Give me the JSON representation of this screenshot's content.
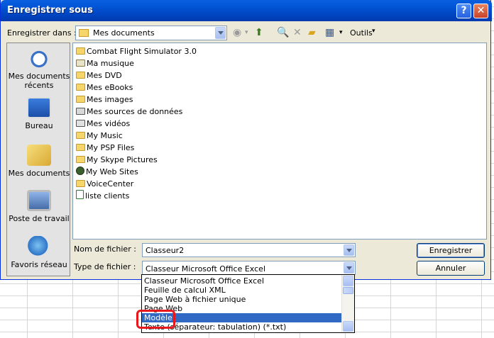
{
  "window": {
    "title": "Enregistrer sous",
    "help_glyph": "?",
    "close_glyph": "✕"
  },
  "toolbar": {
    "save_in_label": "Enregistrer dans :",
    "save_in_value": "Mes documents",
    "tools_label": "Outils"
  },
  "places": [
    {
      "name": "Mes documents récents",
      "icon": "recent-documents-icon"
    },
    {
      "name": "Bureau",
      "icon": "desktop-icon"
    },
    {
      "name": "Mes documents",
      "icon": "my-documents-icon"
    },
    {
      "name": "Poste de travail",
      "icon": "my-computer-icon"
    },
    {
      "name": "Favoris réseau",
      "icon": "network-places-icon"
    }
  ],
  "files": [
    {
      "name": "Combat Flight Simulator 3.0",
      "icon": "folder"
    },
    {
      "name": "Ma musique",
      "icon": "special-folder"
    },
    {
      "name": "Mes DVD",
      "icon": "folder"
    },
    {
      "name": "Mes eBooks",
      "icon": "folder"
    },
    {
      "name": "Mes images",
      "icon": "folder"
    },
    {
      "name": "Mes sources de données",
      "icon": "database-folder"
    },
    {
      "name": "Mes vidéos",
      "icon": "video-folder"
    },
    {
      "name": "My Music",
      "icon": "folder"
    },
    {
      "name": "My PSP Files",
      "icon": "folder"
    },
    {
      "name": "My Skype Pictures",
      "icon": "folder"
    },
    {
      "name": "My Web Sites",
      "icon": "web-folder"
    },
    {
      "name": "VoiceCenter",
      "icon": "folder"
    },
    {
      "name": "liste clients",
      "icon": "excel-file"
    }
  ],
  "form": {
    "filename_label": "Nom de fichier :",
    "filename_value": "Classeur2",
    "filetype_label": "Type de fichier :",
    "filetype_value": "Classeur Microsoft Office Excel",
    "save_button": "Enregistrer",
    "cancel_button": "Annuler"
  },
  "filetype_options": [
    "Classeur Microsoft Office Excel",
    "Feuille de calcul XML",
    "Page Web à fichier unique",
    "Page Web",
    "Modèle",
    "Texte (séparateur: tabulation) (*.txt)"
  ],
  "filetype_selected": "Modèle",
  "colors": {
    "title_bar": "#0258d8",
    "dialog_bg": "#ece9d8",
    "selection": "#316ac5",
    "highlight": "#e8191c"
  }
}
